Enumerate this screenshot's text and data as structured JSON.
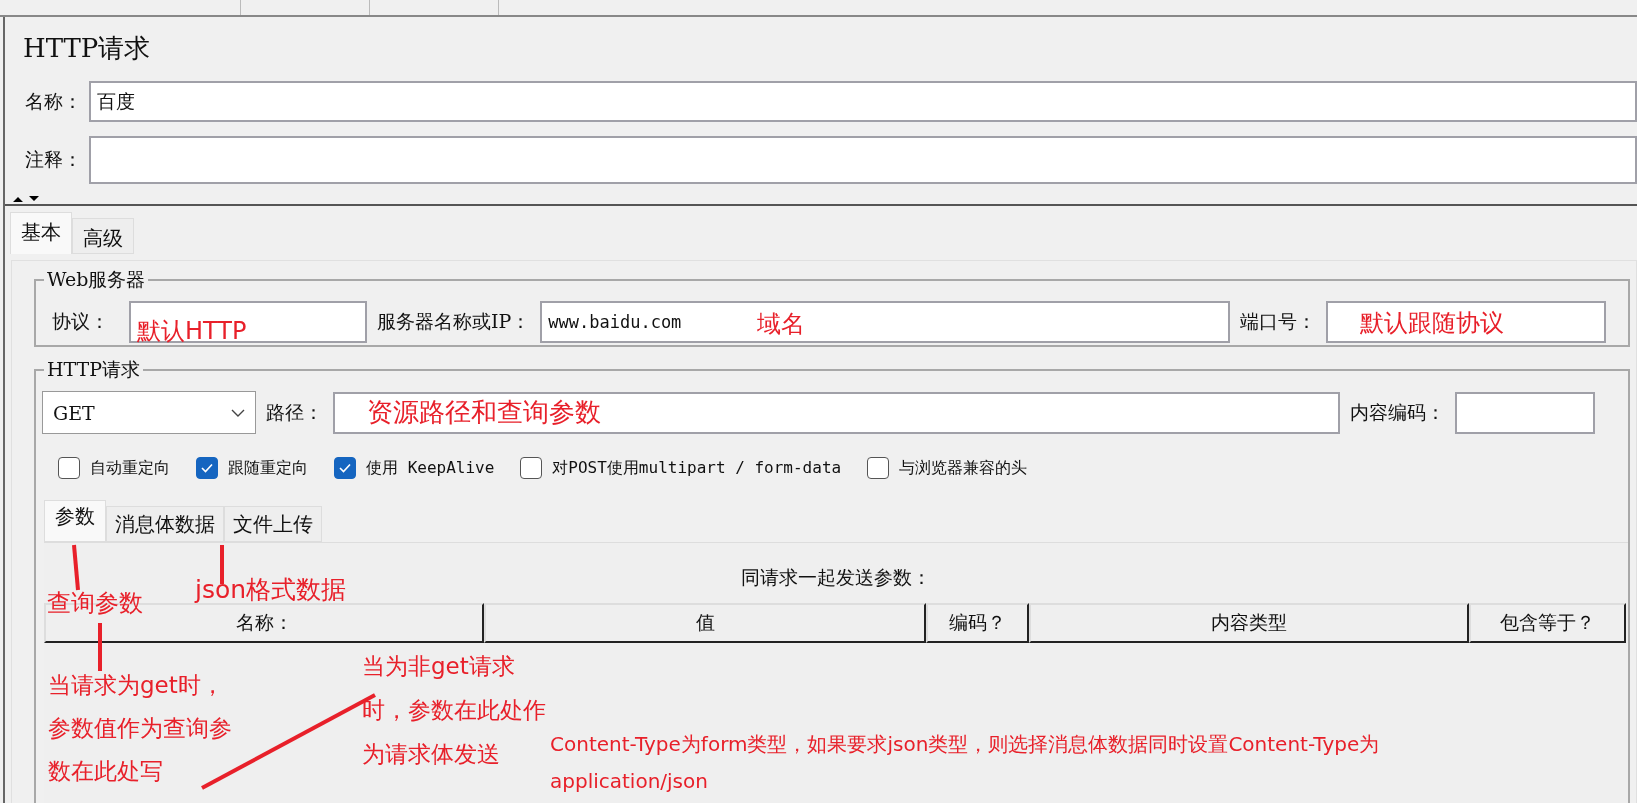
{
  "title": "HTTP请求",
  "name_field": {
    "label": "名称：",
    "value": "百度"
  },
  "comment_field": {
    "label": "注释："
  },
  "tabs": [
    {
      "label": "基本",
      "selected": true
    },
    {
      "label": "高级",
      "selected": false
    }
  ],
  "web_server": {
    "legend": "Web服务器",
    "protocol": {
      "label": "协议："
    },
    "server": {
      "label": "服务器名称或IP：",
      "value": "www.baidu.com"
    },
    "port": {
      "label": "端口号："
    }
  },
  "http_request": {
    "legend": "HTTP请求",
    "method": "GET",
    "path": {
      "label": "路径："
    },
    "encoding": {
      "label": "内容编码："
    },
    "options": [
      {
        "label": "自动重定向",
        "checked": false
      },
      {
        "label": "跟随重定向",
        "checked": true
      },
      {
        "label": "使用 KeepAlive",
        "checked": true
      },
      {
        "label": "对POST使用multipart / form-data",
        "checked": false
      },
      {
        "label": "与浏览器兼容的头",
        "checked": false
      }
    ],
    "subtabs": [
      {
        "label": "参数",
        "selected": true
      },
      {
        "label": "消息体数据",
        "selected": false
      },
      {
        "label": "文件上传",
        "selected": false
      }
    ],
    "params_caption": "同请求一起发送参数：",
    "columns": [
      "名称：",
      "值",
      "编码？",
      "内容类型",
      "包含等于？"
    ]
  },
  "annotations": [
    {
      "lines": [
        "默认HTTP"
      ]
    },
    {
      "lines": [
        "域名"
      ]
    },
    {
      "lines": [
        "默认跟随协议"
      ]
    },
    {
      "lines": [
        "资源路径和查询参数"
      ]
    },
    {
      "lines": [
        "json格式数据"
      ]
    },
    {
      "lines": [
        "查询参数"
      ]
    },
    {
      "lines": [
        "当请求为get时，",
        "参数值作为查询参",
        "数在此处写"
      ]
    },
    {
      "lines": [
        "当为非get请求",
        "时，参数在此处作",
        "为请求体发送"
      ]
    },
    {
      "lines": [
        "Content-Type为form类型，如果要求json类型，则选择消息体数据同时设置Content-Type为",
        "application/json"
      ]
    }
  ]
}
